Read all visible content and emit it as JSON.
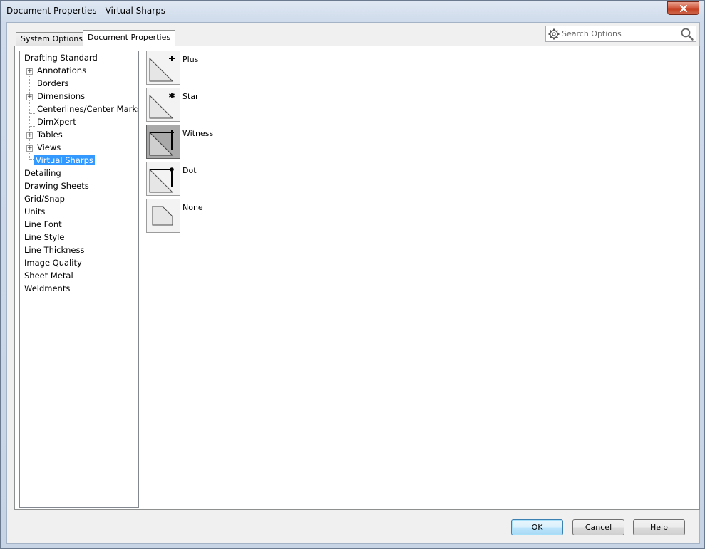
{
  "window": {
    "title": "Document Properties - Virtual Sharps"
  },
  "tabs": {
    "system_options": "System Options",
    "document_properties": "Document Properties"
  },
  "search": {
    "placeholder": "Search Options"
  },
  "tree": {
    "items": [
      {
        "label": "Drafting Standard",
        "level": 0,
        "expander": false
      },
      {
        "label": "Annotations",
        "level": 1,
        "expander": true
      },
      {
        "label": "Borders",
        "level": 1,
        "expander": false
      },
      {
        "label": "Dimensions",
        "level": 1,
        "expander": true
      },
      {
        "label": "Centerlines/Center Marks",
        "level": 1,
        "expander": false
      },
      {
        "label": "DimXpert",
        "level": 1,
        "expander": false
      },
      {
        "label": "Tables",
        "level": 1,
        "expander": true
      },
      {
        "label": "Views",
        "level": 1,
        "expander": true
      },
      {
        "label": "Virtual Sharps",
        "level": 1,
        "expander": false,
        "selected": true
      },
      {
        "label": "Detailing",
        "level": 0,
        "expander": false
      },
      {
        "label": "Drawing Sheets",
        "level": 0,
        "expander": false
      },
      {
        "label": "Grid/Snap",
        "level": 0,
        "expander": false
      },
      {
        "label": "Units",
        "level": 0,
        "expander": false
      },
      {
        "label": "Line Font",
        "level": 0,
        "expander": false
      },
      {
        "label": "Line Style",
        "level": 0,
        "expander": false
      },
      {
        "label": "Line Thickness",
        "level": 0,
        "expander": false
      },
      {
        "label": "Image Quality",
        "level": 0,
        "expander": false
      },
      {
        "label": "Sheet Metal",
        "level": 0,
        "expander": false
      },
      {
        "label": "Weldments",
        "level": 0,
        "expander": false
      }
    ]
  },
  "sharp_options": [
    {
      "label": "Plus",
      "icon": "virtual-sharp-plus-icon",
      "selected": false
    },
    {
      "label": "Star",
      "icon": "virtual-sharp-star-icon",
      "selected": false
    },
    {
      "label": "Witness",
      "icon": "virtual-sharp-witness-icon",
      "selected": true
    },
    {
      "label": "Dot",
      "icon": "virtual-sharp-dot-icon",
      "selected": false
    },
    {
      "label": "None",
      "icon": "virtual-sharp-none-icon",
      "selected": false
    }
  ],
  "buttons": {
    "ok": "OK",
    "cancel": "Cancel",
    "help": "Help"
  },
  "colors": {
    "selection": "#3399ff",
    "active_option": "#a9a9a9"
  }
}
